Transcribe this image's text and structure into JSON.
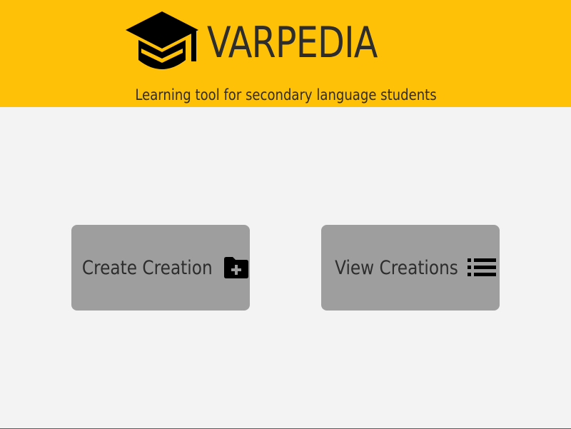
{
  "header": {
    "title": "VARPEDIA",
    "tagline": "Learning tool for secondary language students",
    "logo_icon": "graduation-cap-icon"
  },
  "main": {
    "create_button": {
      "label": "Create Creation",
      "icon": "folder-plus-icon"
    },
    "view_button": {
      "label": "View Creations",
      "icon": "list-icon"
    }
  },
  "colors": {
    "header_bg": "#ffc107",
    "page_bg": "#f3f3f3",
    "button_bg": "#9e9e9e",
    "text": "#2d2d2d"
  }
}
